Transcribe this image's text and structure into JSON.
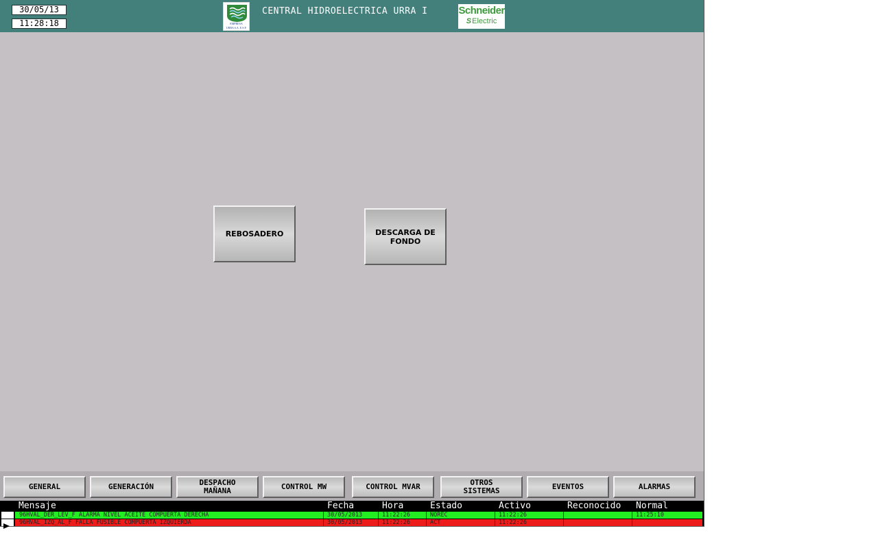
{
  "header": {
    "date": "30/05/13",
    "time": "11:28:18",
    "title": "CENTRAL HIDROELECTRICA URRA I",
    "left_logo": {
      "icon": "urra-logo",
      "line1": "EMPRESA",
      "line2": "URRA S.A. E.S.P."
    },
    "right_logo": {
      "icon": "schneider-electric-logo",
      "brand": "Schneider",
      "sub": "Electric"
    },
    "bg_color": "#437f7b"
  },
  "main": {
    "buttons": [
      {
        "label": "REBOSADERO"
      },
      {
        "label": "DESCARGA DE\nFONDO"
      }
    ],
    "bg_color": "#c4c0c4"
  },
  "nav": [
    {
      "label": "GENERAL"
    },
    {
      "label": "GENERACIÓN"
    },
    {
      "label": "DESPACHO\nMAÑANA"
    },
    {
      "label": "CONTROL MW"
    },
    {
      "label": "CONTROL MVAR"
    },
    {
      "label": "OTROS\nSISTEMAS"
    },
    {
      "label": "EVENTOS"
    },
    {
      "label": "ALARMAS"
    }
  ],
  "alarms": {
    "columns": [
      "Mensaje",
      "Fecha",
      "Hora",
      "Estado",
      "Activo",
      "Reconocido",
      "Normal"
    ],
    "rows": [
      {
        "message": "96HVAL_DER_LEV_F ALARMA NIVEL ACEITE COMPUERTA DERECHA",
        "date": "30/05/2013",
        "time": "11:22:26",
        "state": "NOREC",
        "active": "11:22:26",
        "acknowledged": "",
        "normal": "11:25:10",
        "color": "#22ee22",
        "selected": false
      },
      {
        "message": "96HVAL_IZQ_AL_F FALLA FUSIBLE COMPUERTA IZQUIERDA",
        "date": "30/05/2013",
        "time": "11:22:26",
        "state": "ACT",
        "active": "11:22:26",
        "acknowledged": "",
        "normal": "",
        "color": "#ee1b1b",
        "selected": true
      }
    ]
  }
}
